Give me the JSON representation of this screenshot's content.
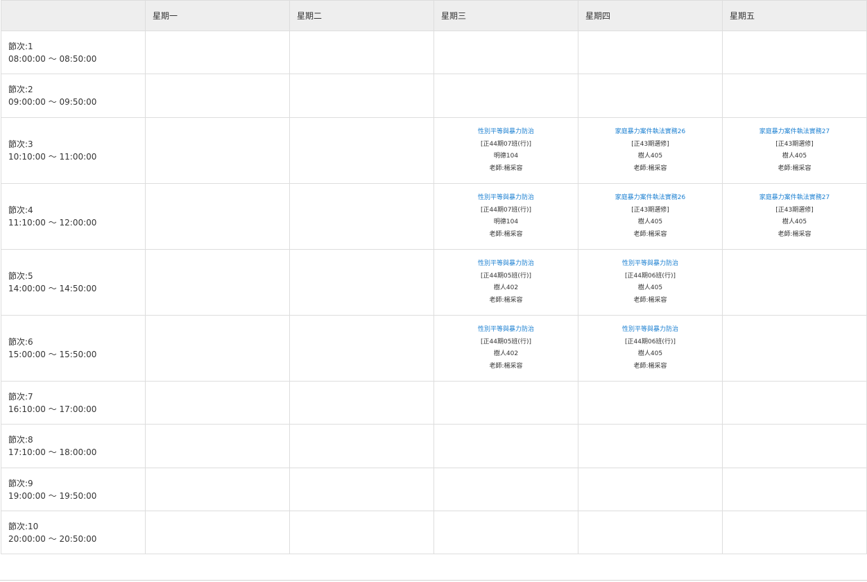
{
  "header": {
    "corner": "",
    "days": [
      "星期一",
      "星期二",
      "星期三",
      "星期四",
      "星期五"
    ]
  },
  "periods": [
    {
      "label": "節次:1",
      "time": "08:00:00 ～ 08:50:00",
      "cells": [
        null,
        null,
        null,
        null,
        null
      ]
    },
    {
      "label": "節次:2",
      "time": "09:00:00 ～ 09:50:00",
      "cells": [
        null,
        null,
        null,
        null,
        null
      ]
    },
    {
      "label": "節次:3",
      "time": "10:10:00 ～ 11:00:00",
      "cells": [
        null,
        null,
        {
          "name": "性別平等與暴力防治",
          "class": "[正44期07班(行)]",
          "room": "明德104",
          "teacher": "老師:楊采容"
        },
        {
          "name": "家庭暴力案件執法實務26",
          "class": "[正43期選修]",
          "room": "樹人405",
          "teacher": "老師:楊采容"
        },
        {
          "name": "家庭暴力案件執法實務27",
          "class": "[正43期選修]",
          "room": "樹人405",
          "teacher": "老師:楊采容"
        }
      ]
    },
    {
      "label": "節次:4",
      "time": "11:10:00 ～ 12:00:00",
      "cells": [
        null,
        null,
        {
          "name": "性別平等與暴力防治",
          "class": "[正44期07班(行)]",
          "room": "明德104",
          "teacher": "老師:楊采容"
        },
        {
          "name": "家庭暴力案件執法實務26",
          "class": "[正43期選修]",
          "room": "樹人405",
          "teacher": "老師:楊采容"
        },
        {
          "name": "家庭暴力案件執法實務27",
          "class": "[正43期選修]",
          "room": "樹人405",
          "teacher": "老師:楊采容"
        }
      ]
    },
    {
      "label": "節次:5",
      "time": "14:00:00 ～ 14:50:00",
      "cells": [
        null,
        null,
        {
          "name": "性別平等與暴力防治",
          "class": "[正44期05班(行)]",
          "room": "樹人402",
          "teacher": "老師:楊采容"
        },
        {
          "name": "性別平等與暴力防治",
          "class": "[正44期06班(行)]",
          "room": "樹人405",
          "teacher": "老師:楊采容"
        },
        null
      ]
    },
    {
      "label": "節次:6",
      "time": "15:00:00 ～ 15:50:00",
      "cells": [
        null,
        null,
        {
          "name": "性別平等與暴力防治",
          "class": "[正44期05班(行)]",
          "room": "樹人402",
          "teacher": "老師:楊采容"
        },
        {
          "name": "性別平等與暴力防治",
          "class": "[正44期06班(行)]",
          "room": "樹人405",
          "teacher": "老師:楊采容"
        },
        null
      ]
    },
    {
      "label": "節次:7",
      "time": "16:10:00 ～ 17:00:00",
      "cells": [
        null,
        null,
        null,
        null,
        null
      ]
    },
    {
      "label": "節次:8",
      "time": "17:10:00 ～ 18:00:00",
      "cells": [
        null,
        null,
        null,
        null,
        null
      ]
    },
    {
      "label": "節次:9",
      "time": "19:00:00 ～ 19:50:00",
      "cells": [
        null,
        null,
        null,
        null,
        null
      ]
    },
    {
      "label": "節次:10",
      "time": "20:00:00 ～ 20:50:00",
      "cells": [
        null,
        null,
        null,
        null,
        null
      ]
    }
  ],
  "colors": {
    "link": "#1a7fd1",
    "header_bg": "#eeeeee",
    "border": "#dddddd"
  }
}
